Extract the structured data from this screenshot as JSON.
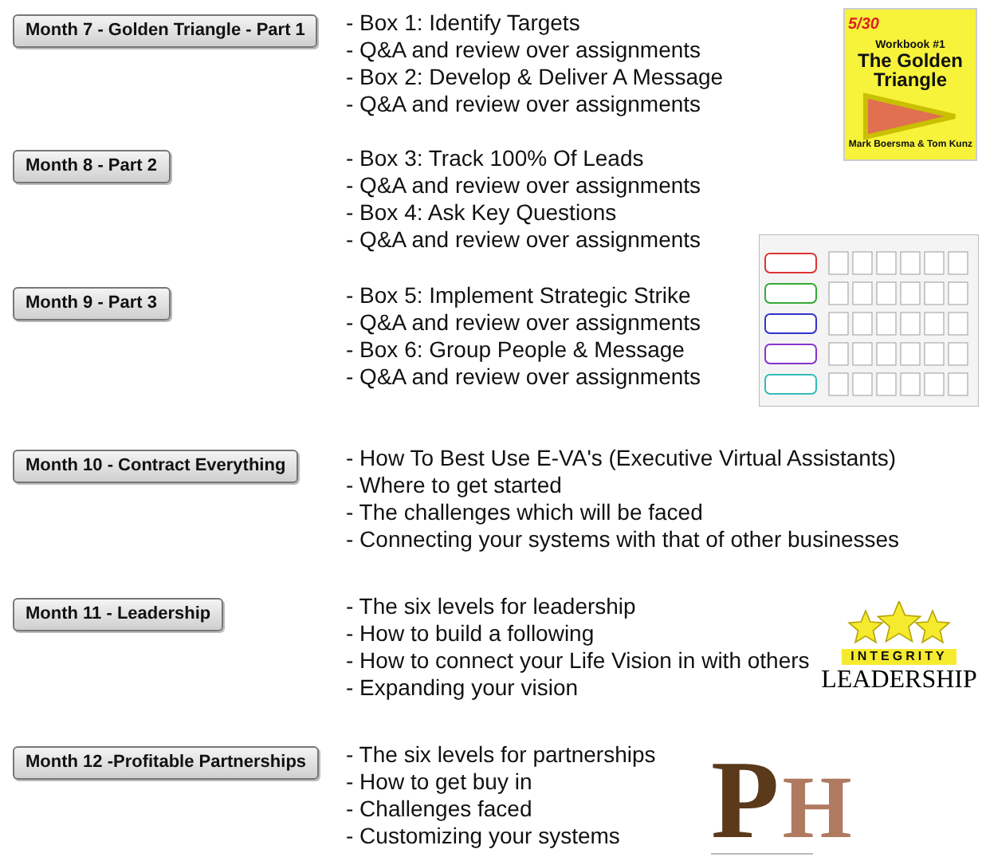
{
  "sections": [
    {
      "button": "Month 7 - Golden Triangle - Part 1",
      "items": [
        "- Box 1: Identify Targets",
        "- Q&A and review over assignments",
        "- Box 2: Develop & Deliver A Message",
        "- Q&A and review over assignments"
      ],
      "picture": {
        "kind": "book",
        "brand": "5/30",
        "subtitle": "Workbook #1",
        "title": "The Golden Triangle",
        "authors": [
          "Mark Boersma",
          "& Tom Kunz"
        ]
      }
    },
    {
      "button": "Month 8 - Part 2",
      "items": [
        "- Box 3: Track 100% Of Leads",
        "- Q&A and review over assignments",
        "- Box 4: Ask Key Questions",
        "- Q&A and review over assignments"
      ]
    },
    {
      "button": "Month 9 - Part 3",
      "items": [
        "- Box 5: Implement Strategic Strike",
        "- Q&A and review over assignments",
        "- Box 6: Group People & Message",
        "- Q&A and review over assignments"
      ],
      "picture": {
        "kind": "grid"
      }
    },
    {
      "button": "Month 10 - Contract Everything",
      "items": [
        "- How To Best Use E-VA's (Executive Virtual Assistants)",
        "- Where to get started",
        "- The challenges which will be faced",
        "- Connecting your systems with that of other businesses"
      ]
    },
    {
      "button": "Month 11 - Leadership",
      "items": [
        "- The six levels for leadership",
        "- How to build a following",
        "- How to connect your Life Vision in with others",
        "- Expanding your vision"
      ],
      "picture": {
        "kind": "stars",
        "top": "INTEGRITY",
        "bottom": "LEADERSHIP"
      }
    },
    {
      "button": "Month 12 -Profitable Partnerships",
      "items": [
        "- The six levels for partnerships",
        "- How to get buy in",
        "- Challenges faced",
        "- Customizing your systems"
      ],
      "picture": {
        "kind": "monogram",
        "letters": [
          "P",
          "H"
        ]
      }
    }
  ]
}
